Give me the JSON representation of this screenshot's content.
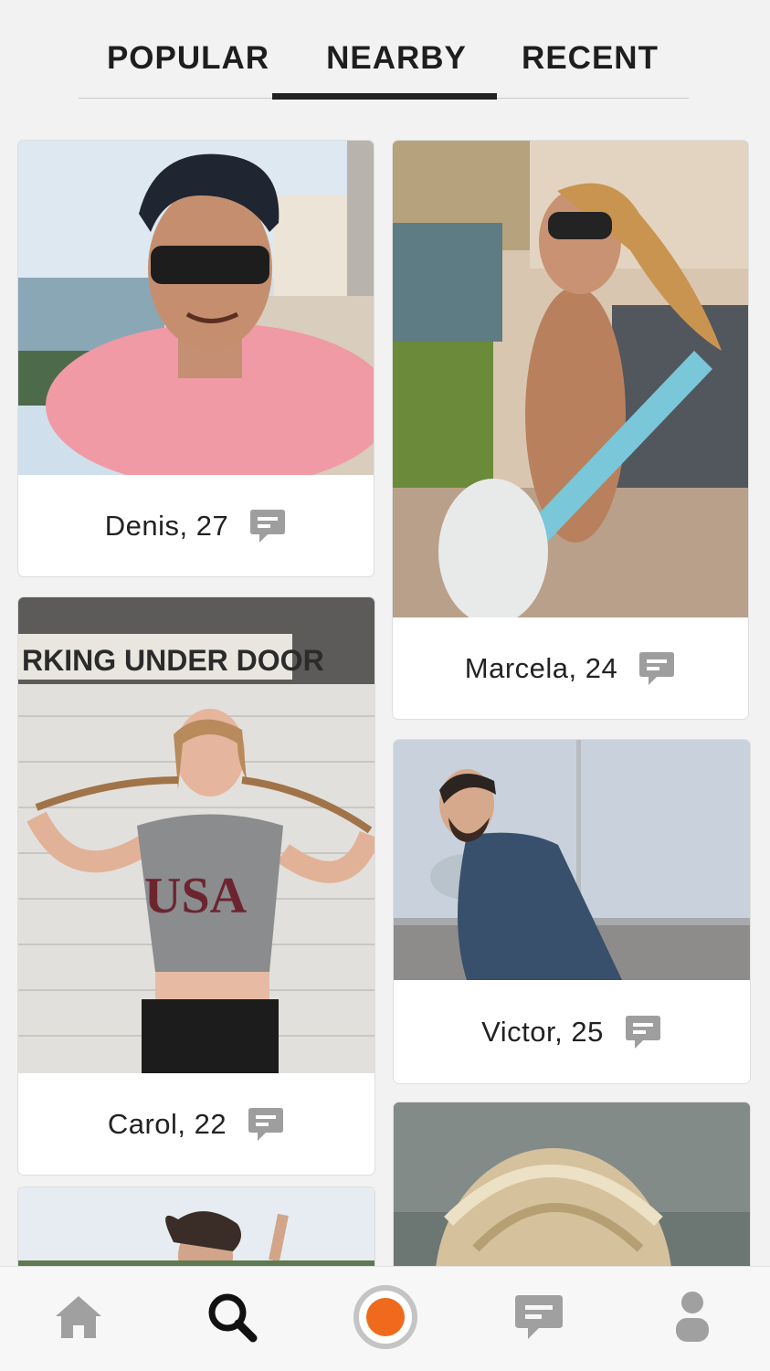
{
  "tabs": [
    {
      "label": "POPULAR",
      "active": false
    },
    {
      "label": "NEARBY",
      "active": true
    },
    {
      "label": "RECENT",
      "active": false
    }
  ],
  "profiles": [
    {
      "name": "Denis, 27"
    },
    {
      "name": "Marcela, 24"
    },
    {
      "name": "Carol, 22"
    },
    {
      "name": "Victor, 25"
    }
  ],
  "photo_text": {
    "sign": "RKING UNDER DOOR",
    "shirt": "USA"
  },
  "colors": {
    "accent": "#f06a1d",
    "icon_gray": "#a0a0a0",
    "active_icon": "#111111"
  },
  "nav": [
    {
      "icon": "home-icon"
    },
    {
      "icon": "search-icon",
      "active": true
    },
    {
      "icon": "record-icon"
    },
    {
      "icon": "chat-icon"
    },
    {
      "icon": "profile-icon"
    }
  ]
}
